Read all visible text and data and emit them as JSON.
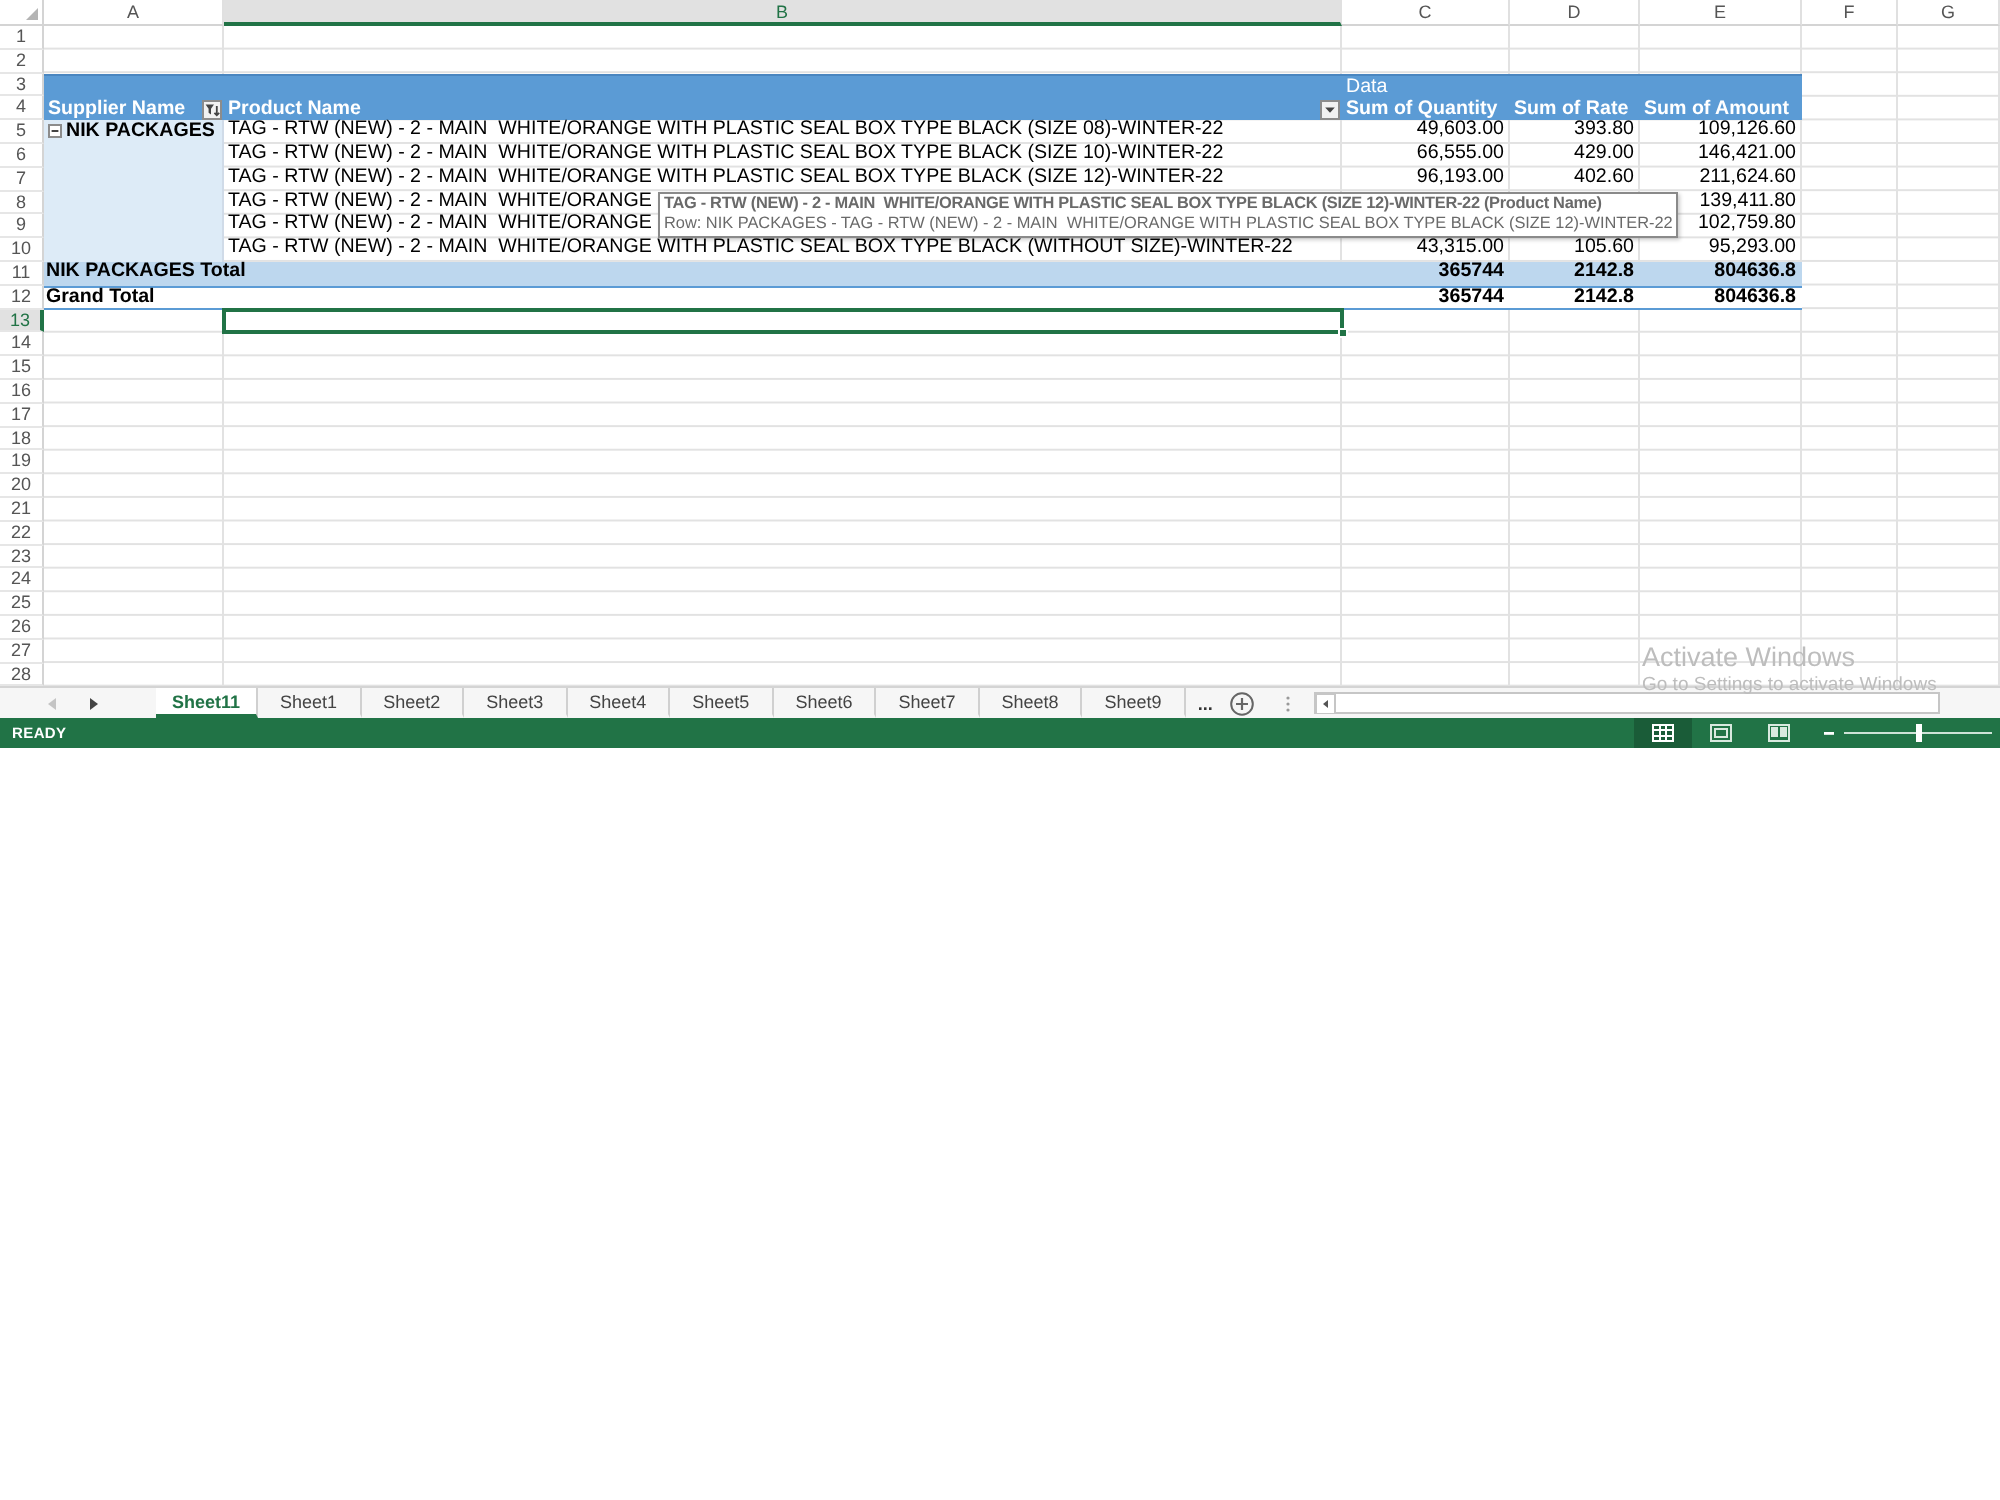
{
  "column_headers": [
    {
      "label": "A",
      "selected": false
    },
    {
      "label": "B",
      "selected": true
    },
    {
      "label": "C",
      "selected": false
    },
    {
      "label": "D",
      "selected": false
    },
    {
      "label": "E",
      "selected": false
    },
    {
      "label": "F",
      "selected": false
    },
    {
      "label": "G",
      "selected": false
    }
  ],
  "row_numbers": [
    {
      "label": "1",
      "selected": false
    },
    {
      "label": "2",
      "selected": false
    },
    {
      "label": "3",
      "selected": false
    },
    {
      "label": "4",
      "selected": false
    },
    {
      "label": "5",
      "selected": false
    },
    {
      "label": "6",
      "selected": false
    },
    {
      "label": "7",
      "selected": false
    },
    {
      "label": "8",
      "selected": false
    },
    {
      "label": "9",
      "selected": false
    },
    {
      "label": "10",
      "selected": false
    },
    {
      "label": "11",
      "selected": false
    },
    {
      "label": "12",
      "selected": false
    },
    {
      "label": "13",
      "selected": true
    },
    {
      "label": "14",
      "selected": false
    },
    {
      "label": "15",
      "selected": false
    },
    {
      "label": "16",
      "selected": false
    },
    {
      "label": "17",
      "selected": false
    },
    {
      "label": "18",
      "selected": false
    },
    {
      "label": "19",
      "selected": false
    },
    {
      "label": "20",
      "selected": false
    },
    {
      "label": "21",
      "selected": false
    },
    {
      "label": "22",
      "selected": false
    },
    {
      "label": "23",
      "selected": false
    },
    {
      "label": "24",
      "selected": false
    },
    {
      "label": "25",
      "selected": false
    },
    {
      "label": "26",
      "selected": false
    },
    {
      "label": "27",
      "selected": false
    },
    {
      "label": "28",
      "selected": false
    }
  ],
  "pivot_table": {
    "data_label": "Data",
    "supplier_header": {
      "label": "Supplier Name",
      "filtered": true
    },
    "product_header": {
      "label": "Product Name",
      "filtered": false
    },
    "value_headers": [
      "Sum of Quantity",
      "Sum of Rate",
      "Sum of Amount"
    ],
    "supplier": {
      "name": "NIK PACKAGES",
      "expanded": true
    },
    "rows": [
      {
        "product": "TAG - RTW (NEW) - 2 - MAIN  WHITE/ORANGE WITH PLASTIC SEAL BOX TYPE BLACK (SIZE 08)-WINTER-22",
        "quantity": "49,603.00",
        "rate": "393.80",
        "amount": "109,126.60"
      },
      {
        "product": "TAG - RTW (NEW) - 2 - MAIN  WHITE/ORANGE WITH PLASTIC SEAL BOX TYPE BLACK (SIZE 10)-WINTER-22",
        "quantity": "66,555.00",
        "rate": "429.00",
        "amount": "146,421.00"
      },
      {
        "product": "TAG - RTW (NEW) - 2 - MAIN  WHITE/ORANGE WITH PLASTIC SEAL BOX TYPE BLACK (SIZE 12)-WINTER-22",
        "quantity": "96,193.00",
        "rate": "402.60",
        "amount": "211,624.60"
      },
      {
        "product": "TAG - RTW (NEW) - 2 - MAIN  WHITE/ORANGE",
        "amount": "139,411.80"
      },
      {
        "product": "TAG - RTW (NEW) - 2 - MAIN  WHITE/ORANGE",
        "amount": "102,759.80"
      },
      {
        "product": "TAG - RTW (NEW) - 2 - MAIN  WHITE/ORANGE WITH PLASTIC SEAL BOX TYPE BLACK (WITHOUT SIZE)-WINTER-22",
        "quantity": "43,315.00",
        "rate": "105.60",
        "amount": "95,293.00"
      }
    ],
    "subtotal": {
      "label": "NIK PACKAGES Total",
      "quantity": "365744",
      "rate": "2142.8",
      "amount": "804636.8"
    },
    "grand_total": {
      "label": "Grand Total",
      "quantity": "365744",
      "rate": "2142.8",
      "amount": "804636.8"
    }
  },
  "tooltip": {
    "title": "TAG - RTW (NEW) - 2 - MAIN  WHITE/ORANGE WITH PLASTIC SEAL BOX TYPE BLACK (SIZE 12)-WINTER-22 (Product Name)",
    "text": "Row: NIK PACKAGES - TAG - RTW (NEW) - 2 - MAIN  WHITE/ORANGE WITH PLASTIC SEAL BOX TYPE BLACK (SIZE 12)-WINTER-22"
  },
  "sheet_nav": [
    {
      "kind": "previous",
      "disabled": true
    },
    {
      "kind": "next",
      "disabled": false
    }
  ],
  "sheet_tabs": [
    {
      "label": "Sheet11",
      "selected": true
    },
    {
      "label": "Sheet1",
      "selected": false
    },
    {
      "label": "Sheet2",
      "selected": false
    },
    {
      "label": "Sheet3",
      "selected": false
    },
    {
      "label": "Sheet4",
      "selected": false
    },
    {
      "label": "Sheet5",
      "selected": false
    },
    {
      "label": "Sheet6",
      "selected": false
    },
    {
      "label": "Sheet7",
      "selected": false
    },
    {
      "label": "Sheet8",
      "selected": false
    },
    {
      "label": "Sheet9",
      "selected": false
    }
  ],
  "more_tabs": "...",
  "status_bar": {
    "status": "READY",
    "views": [
      {
        "kind": "normal",
        "selected": true
      },
      {
        "kind": "page_layout",
        "selected": false
      },
      {
        "kind": "page_break",
        "selected": false
      }
    ],
    "zoom": {
      "level": 0.5
    }
  },
  "activation_notice": {
    "title": "Activate Windows",
    "text": "Go to Settings to activate Windows"
  }
}
